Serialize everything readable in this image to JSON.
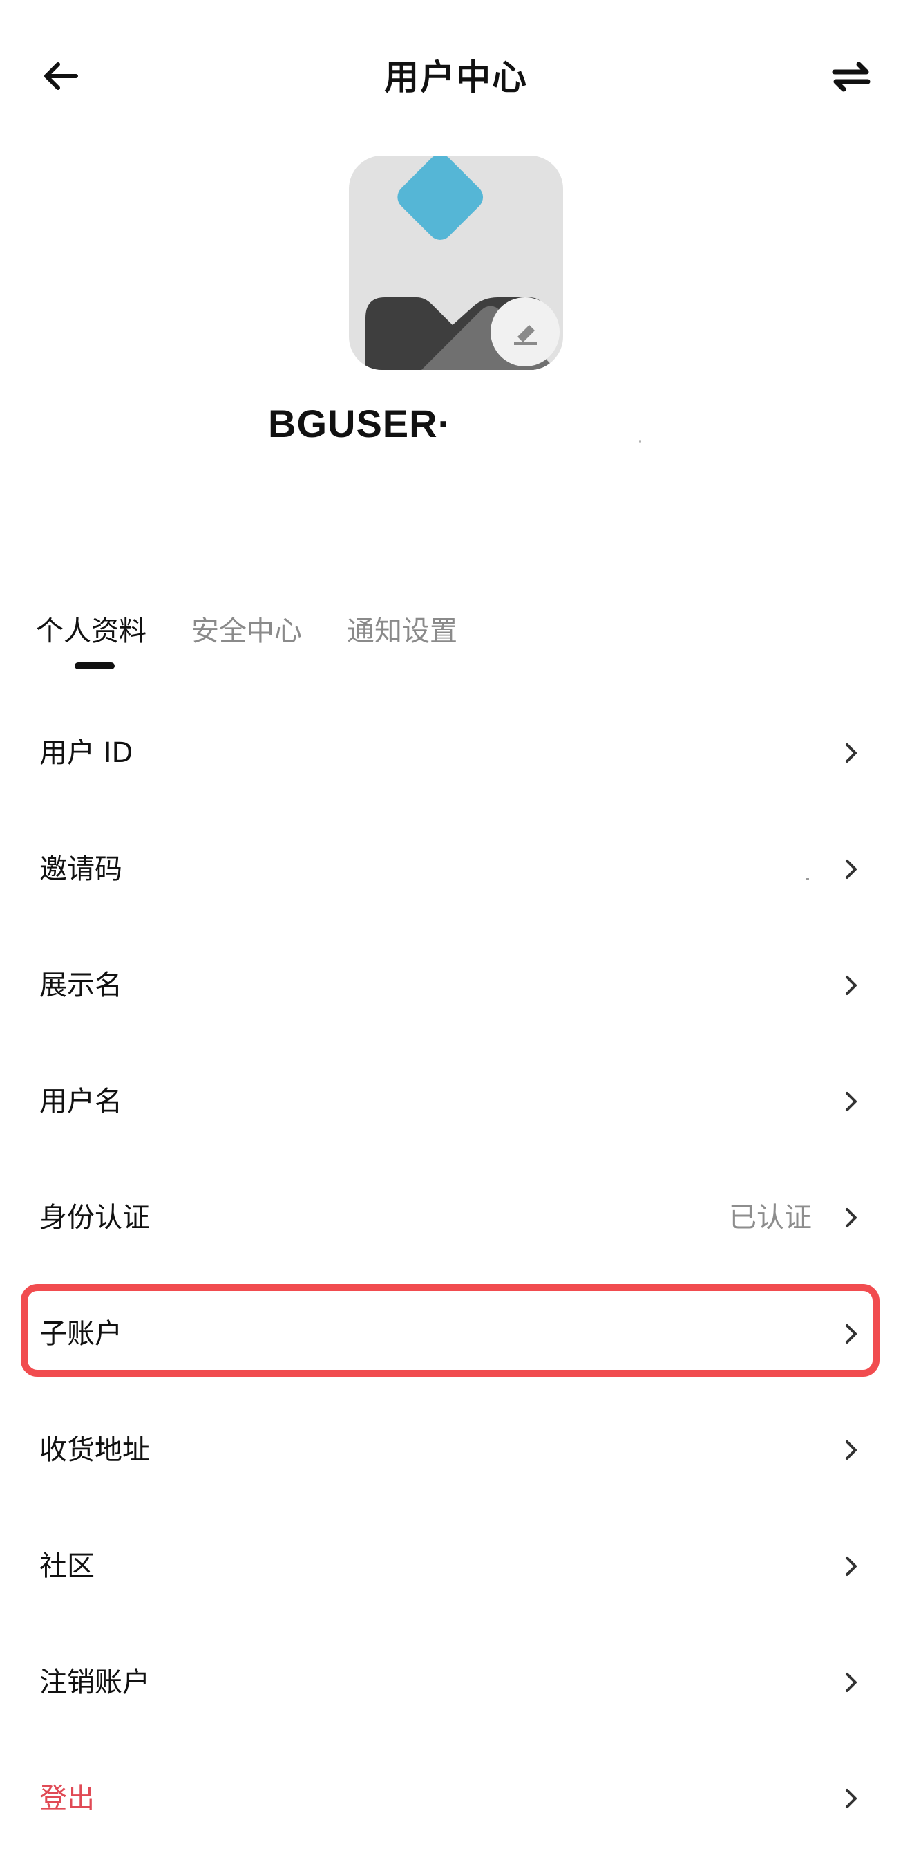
{
  "header": {
    "title": "用户中心",
    "back_icon": "arrow-left-icon",
    "switch_icon": "swap-arrows-icon"
  },
  "profile": {
    "username": "BGUSER·",
    "avatar_icon": "placeholder-image-icon",
    "edit_icon": "pencil-eraser-icon",
    "avatar_accent_color": "#55b6d6"
  },
  "tabs": [
    {
      "label": "个人资料",
      "active": true
    },
    {
      "label": "安全中心",
      "active": false
    },
    {
      "label": "通知设置",
      "active": false
    }
  ],
  "list": [
    {
      "label": "用户 ID",
      "value": ""
    },
    {
      "label": "邀请码",
      "value": ""
    },
    {
      "label": "展示名",
      "value": ""
    },
    {
      "label": "用户名",
      "value": ""
    },
    {
      "label": "身份认证",
      "value": "已认证"
    },
    {
      "label": "子账户",
      "value": "",
      "highlighted": true
    },
    {
      "label": "收货地址",
      "value": ""
    },
    {
      "label": "社区",
      "value": ""
    },
    {
      "label": "注销账户",
      "value": ""
    },
    {
      "label": "登出",
      "value": "",
      "danger": true
    }
  ],
  "colors": {
    "highlight_border": "#f14c4f",
    "danger_text": "#e04a55",
    "secondary_text": "#8d8d8d"
  }
}
